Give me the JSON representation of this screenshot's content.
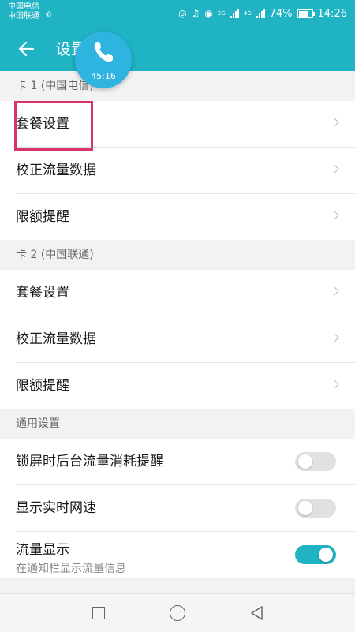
{
  "status_bar": {
    "carrier_1": "中国电信",
    "carrier_2": "中国联通",
    "battery_percent": "74%",
    "battery_level": 0.74,
    "time": "14:26",
    "signal_1_label": "2G",
    "signal_2_label": "4G",
    "icons": [
      "call-active-icon",
      "hotspot-icon",
      "headset-icon",
      "eye-icon",
      "signal-icon",
      "battery-icon"
    ]
  },
  "app_bar": {
    "title": "设置",
    "back_icon": "arrow-left-icon"
  },
  "call_bubble": {
    "timer": "45:16",
    "icon": "phone-icon"
  },
  "sections": [
    {
      "header": "卡 1 (中国电信)",
      "items": [
        {
          "label": "套餐设置",
          "type": "link"
        },
        {
          "label": "校正流量数据",
          "type": "link"
        },
        {
          "label": "限额提醒",
          "type": "link"
        }
      ]
    },
    {
      "header": "卡 2 (中国联通)",
      "items": [
        {
          "label": "套餐设置",
          "type": "link"
        },
        {
          "label": "校正流量数据",
          "type": "link"
        },
        {
          "label": "限额提醒",
          "type": "link"
        }
      ]
    },
    {
      "header": "通用设置",
      "items": [
        {
          "label": "锁屏时后台流量消耗提醒",
          "type": "toggle",
          "on": false
        },
        {
          "label": "显示实时网速",
          "type": "toggle",
          "on": false
        },
        {
          "label": "流量显示",
          "sublabel": "在通知栏显示流量信息",
          "type": "toggle",
          "on": true
        }
      ]
    }
  ],
  "nav_bar": {
    "icons": [
      "recent-apps-icon",
      "home-icon",
      "back-icon"
    ]
  },
  "colors": {
    "accent": "#1fb3c4",
    "call_bubble": "#2fb3df",
    "highlight": "#d8336b"
  }
}
